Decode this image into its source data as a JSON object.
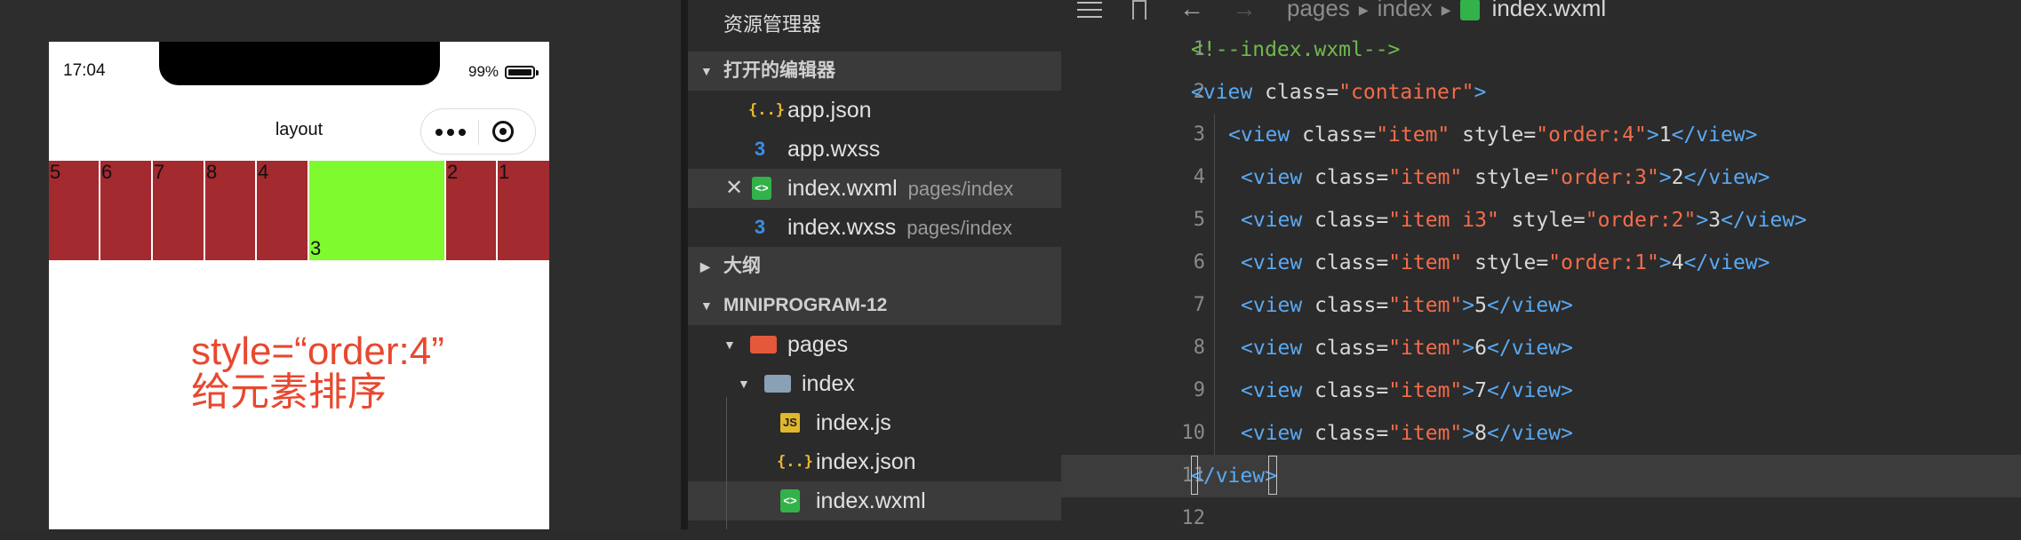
{
  "simulator": {
    "status_time": "17:04",
    "battery_pct": "99%",
    "nav_title": "layout",
    "items": [
      {
        "label": "5",
        "order": 0
      },
      {
        "label": "6",
        "order": 0
      },
      {
        "label": "7",
        "order": 0
      },
      {
        "label": "8",
        "order": 0
      },
      {
        "label": "4",
        "order": 1
      },
      {
        "label": "3",
        "order": 2
      },
      {
        "label": "2",
        "order": 3
      },
      {
        "label": "1",
        "order": 4
      }
    ],
    "annotation_line1": "style=“order:4”",
    "annotation_line2": "给元素排序"
  },
  "explorer": {
    "title": "资源管理器",
    "open_editors": "打开的编辑器",
    "open_files": [
      {
        "name": "app.json",
        "icon": "json-icon",
        "path": ""
      },
      {
        "name": "app.wxss",
        "icon": "css-icon",
        "path": ""
      },
      {
        "name": "index.wxml",
        "icon": "wxml-icon",
        "path": "pages/index"
      },
      {
        "name": "index.wxss",
        "icon": "css-icon",
        "path": "pages/index"
      }
    ],
    "outline": "大纲",
    "project": "MINIPROGRAM-12",
    "tree": {
      "pages": "pages",
      "index": "index",
      "files": [
        {
          "name": "index.js",
          "icon": "js-icon"
        },
        {
          "name": "index.json",
          "icon": "json-icon"
        },
        {
          "name": "index.wxml",
          "icon": "wxml-icon"
        }
      ]
    }
  },
  "editor": {
    "breadcrumb": [
      "pages",
      "index",
      "index.wxml"
    ],
    "lines": [
      {
        "n": "1",
        "comment": "<!--index.wxml-->"
      },
      {
        "n": "2",
        "open": "<view",
        "attr1": " class=",
        "val1": "\"container\"",
        "close": ">"
      },
      {
        "n": "3",
        "open": "<view",
        "attr1": " class=",
        "val1": "\"item\"",
        "attr2": " style=",
        "val2": "\"order:4\"",
        "close": ">",
        "text": "1",
        "end": "</view>"
      },
      {
        "n": "4",
        "open": "<view",
        "attr1": " class=",
        "val1": "\"item\"",
        "attr2": " style=",
        "val2": "\"order:3\"",
        "close": ">",
        "text": "2",
        "end": "</view>"
      },
      {
        "n": "5",
        "open": "<view",
        "attr1": " class=",
        "val1": "\"item i3\"",
        "attr2": " style=",
        "val2": "\"order:2\"",
        "close": ">",
        "text": "3",
        "end": "</view>"
      },
      {
        "n": "6",
        "open": "<view",
        "attr1": " class=",
        "val1": "\"item\"",
        "attr2": " style=",
        "val2": "\"order:1\"",
        "close": ">",
        "text": "4",
        "end": "</view>"
      },
      {
        "n": "7",
        "open": "<view",
        "attr1": " class=",
        "val1": "\"item\"",
        "close": ">",
        "text": "5",
        "end": "</view>"
      },
      {
        "n": "8",
        "open": "<view",
        "attr1": " class=",
        "val1": "\"item\"",
        "close": ">",
        "text": "6",
        "end": "</view>"
      },
      {
        "n": "9",
        "open": "<view",
        "attr1": " class=",
        "val1": "\"item\"",
        "close": ">",
        "text": "7",
        "end": "</view>"
      },
      {
        "n": "10",
        "open": "<view",
        "attr1": " class=",
        "val1": "\"item\"",
        "close": ">",
        "text": "8",
        "end": "</view>"
      },
      {
        "n": "11",
        "end": "</view>"
      },
      {
        "n": "12"
      }
    ]
  },
  "colors": {
    "item_red": "#a32a2f",
    "item_green": "#7ffa2f",
    "annotation": "#e8482f",
    "tag": "#5aa9f2",
    "string": "#f46c4b",
    "comment": "#70b94f"
  }
}
